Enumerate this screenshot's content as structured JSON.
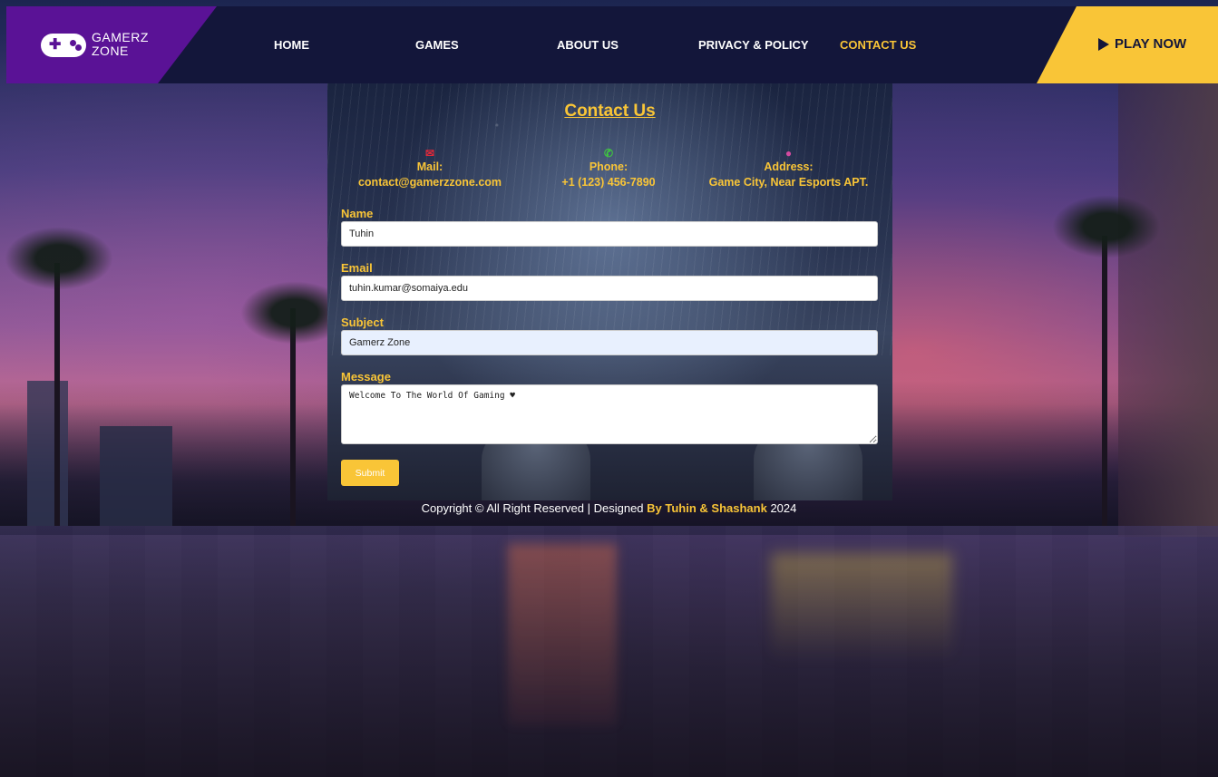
{
  "brand": {
    "line1": "GAMERZ",
    "line2": "ZONE",
    "icon": "gamepad-icon"
  },
  "nav": {
    "items": [
      {
        "label": "HOME",
        "active": false
      },
      {
        "label": "GAMES",
        "active": false
      },
      {
        "label": "ABOUT US",
        "active": false
      },
      {
        "label": "PRIVACY & POLICY",
        "active": false
      },
      {
        "label": "CONTACT US",
        "active": true
      }
    ],
    "play_now": "PLAY NOW"
  },
  "contact": {
    "title": "Contact Us",
    "mail": {
      "label": "Mail:",
      "value": "contact@gamerzzone.com",
      "icon": "envelope-icon",
      "icon_color": "#e0283a"
    },
    "phone": {
      "label": "Phone:",
      "value": "+1 (123) 456-7890",
      "icon": "phone-icon",
      "icon_color": "#3fc83f"
    },
    "address": {
      "label": "Address:",
      "value": "Game City, Near Esports APT.",
      "icon": "map-pin-icon",
      "icon_color": "#d44aa0"
    }
  },
  "form": {
    "name_label": "Name",
    "name_value": "Tuhin",
    "email_label": "Email",
    "email_value": "tuhin.kumar@somaiya.edu",
    "subject_label": "Subject",
    "subject_value": "Gamerz Zone",
    "message_label": "Message",
    "message_value": "Welcome To The World Of Gaming ♥",
    "submit_label": "Submit"
  },
  "footer": {
    "prefix": "Copyright © All Right Reserved | Designed ",
    "by": "By Tuhin & Shashank",
    "year": " 2024"
  },
  "colors": {
    "accent": "#f9c537",
    "header_bg": "#13163a",
    "brand_bg": "#5a1296"
  }
}
